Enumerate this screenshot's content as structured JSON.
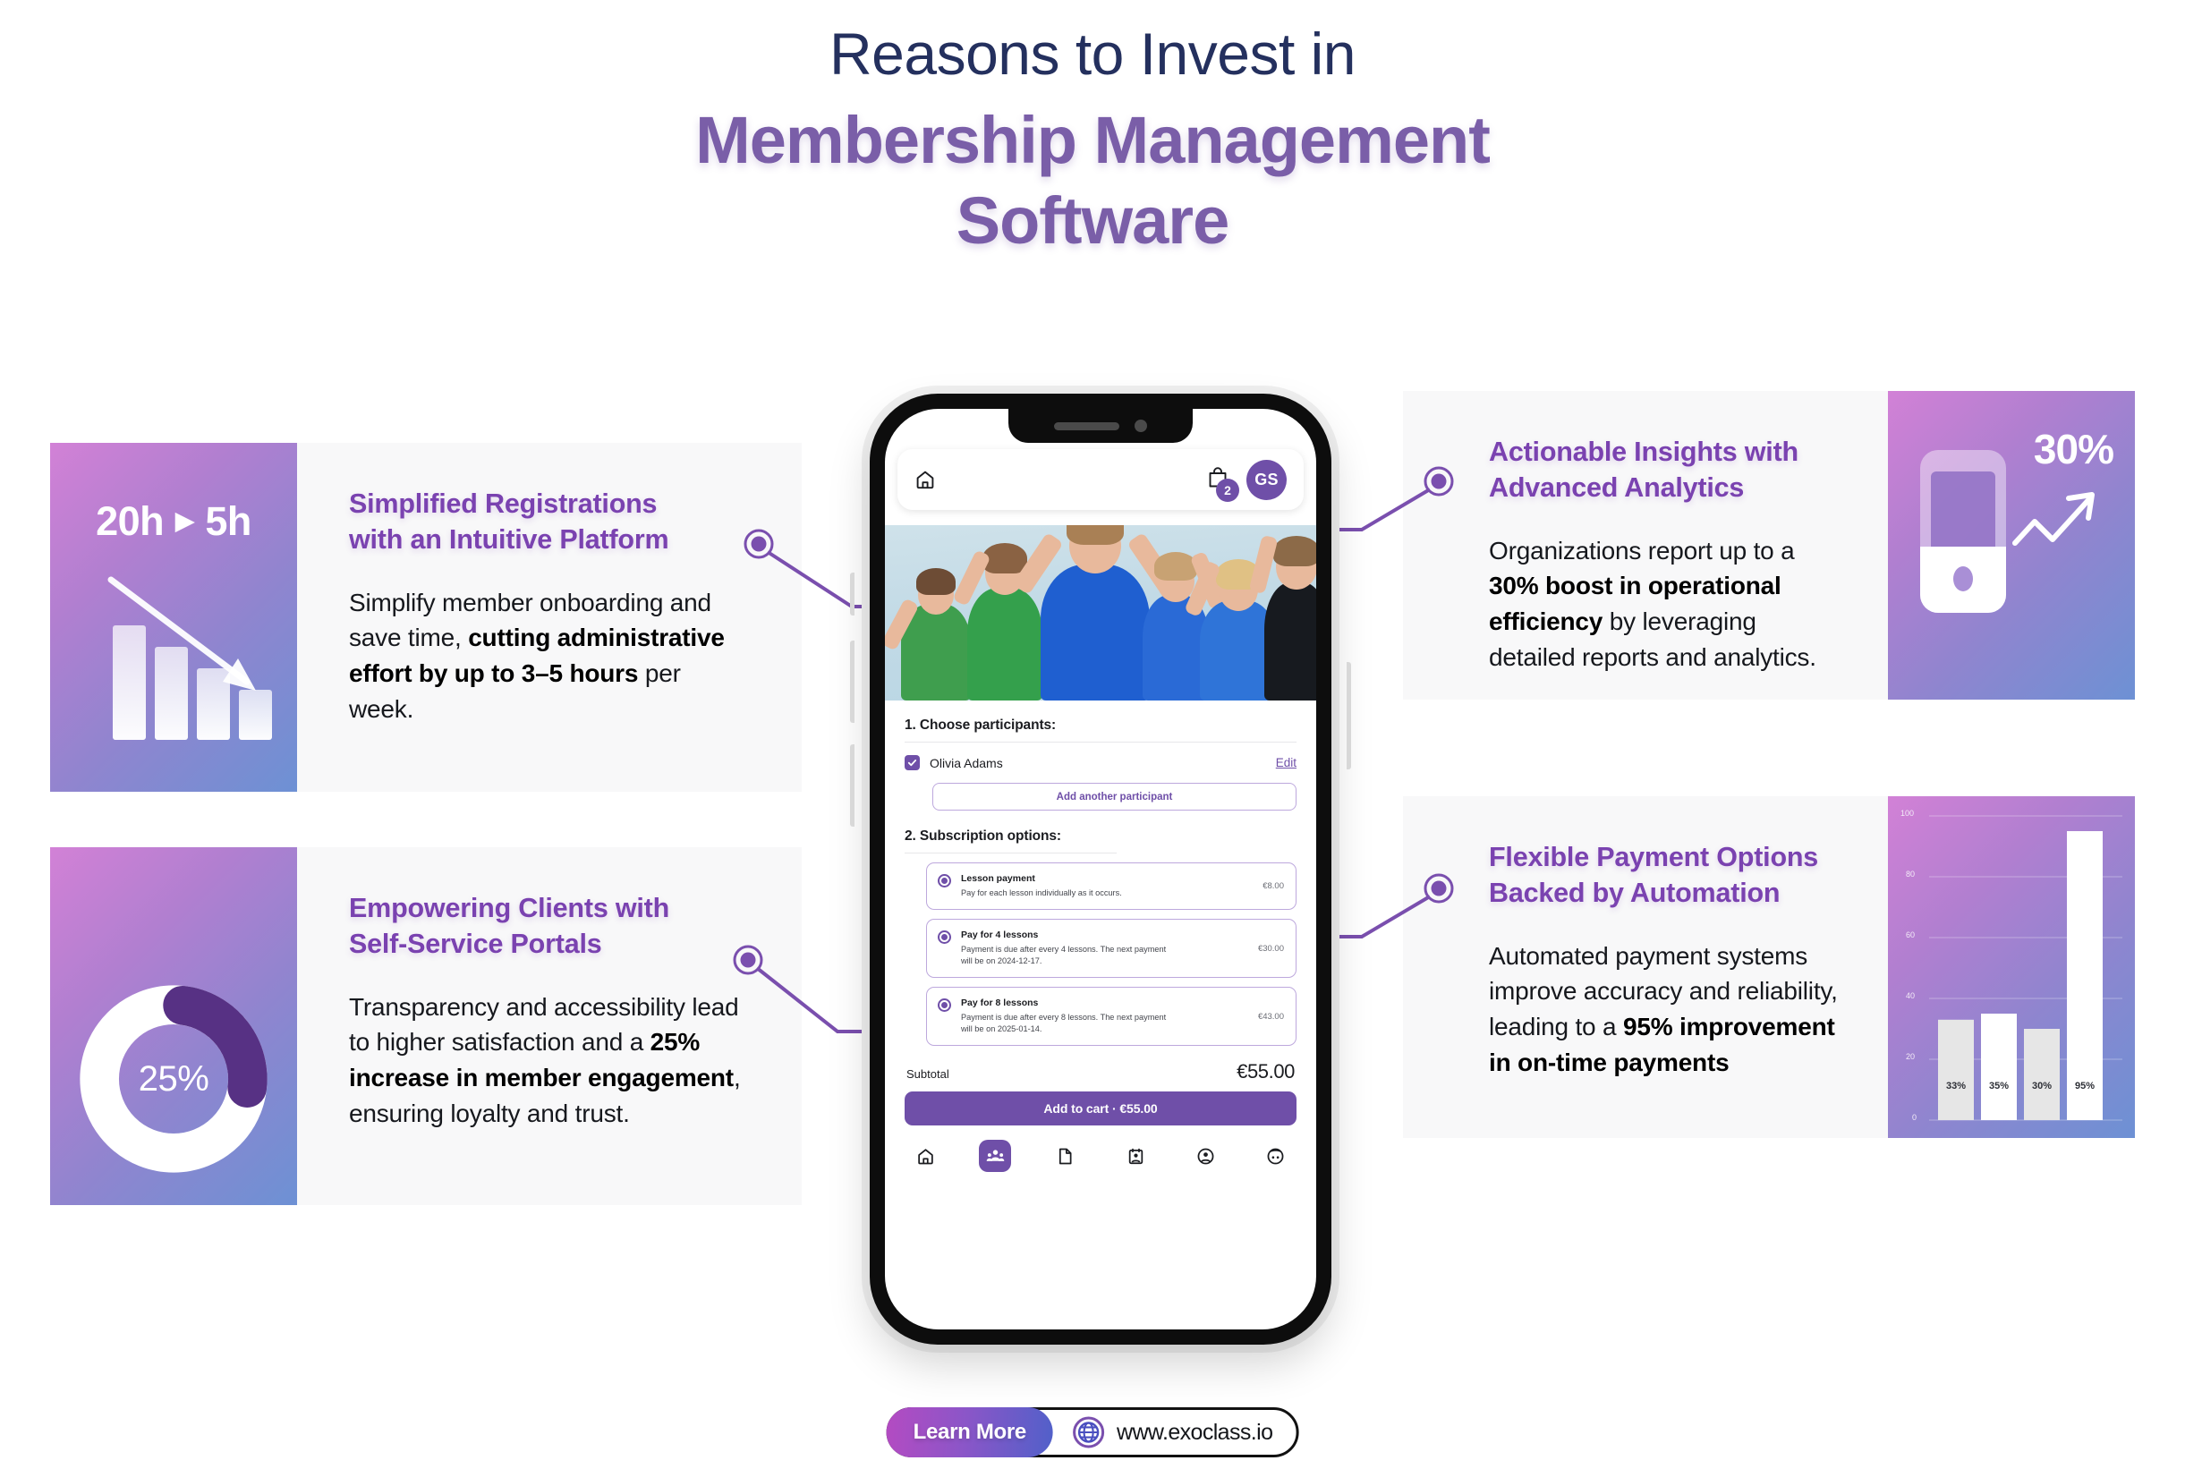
{
  "title": {
    "line1": "Reasons to Invest in",
    "line2_a": "Membership Management",
    "line2_b": "Software",
    "color_navy": "#24305e",
    "color_purple": "#7a5ea8"
  },
  "cards": [
    {
      "id": "simplified-registrations",
      "heading_l1": "Simplified Registrations",
      "heading_l2": "with an Intuitive Platform",
      "body_parts": [
        {
          "t": "Simplify member onboarding and save time, ",
          "b": false
        },
        {
          "t": "cutting administrative effort by up to 3–5 hours",
          "b": true
        },
        {
          "t": " per week.",
          "b": false
        }
      ],
      "visual": {
        "kind": "bars-down",
        "from_label": "20h",
        "to_label": "5h",
        "arrow_glyph": "▶",
        "bar_heights": [
          128,
          104,
          80,
          56
        ]
      }
    },
    {
      "id": "empowering-clients",
      "heading_l1": "Empowering Clients with",
      "heading_l2": "Self-Service Portals",
      "body_parts": [
        {
          "t": "Transparency and accessibility lead to higher satisfaction and a ",
          "b": false
        },
        {
          "t": "25% increase in member engagement",
          "b": true
        },
        {
          "t": ", ensuring loyalty and trust.",
          "b": false
        }
      ],
      "visual": {
        "kind": "donut",
        "percent_label": "25%",
        "percent_value": 25
      }
    },
    {
      "id": "actionable-insights",
      "heading_l1": "Actionable Insights with",
      "heading_l2": "Advanced Analytics",
      "body_parts": [
        {
          "t": "Organizations report up to a ",
          "b": false
        },
        {
          "t": "30% boost in operational efficiency",
          "b": true
        },
        {
          "t": " by leveraging detailed reports and analytics.",
          "b": false
        }
      ],
      "visual": {
        "kind": "phone-trend",
        "percent_label": "30%"
      }
    },
    {
      "id": "flexible-payment-options",
      "heading_l1": "Flexible Payment Options",
      "heading_l2": "Backed by Automation",
      "body_parts": [
        {
          "t": "Automated payment systems improve accuracy and reliability, leading to a ",
          "b": false
        },
        {
          "t": "95% improvement in on-time payments",
          "b": true
        }
      ],
      "visual": {
        "kind": "bar-chart"
      }
    }
  ],
  "chart_data": {
    "type": "bar",
    "title": "",
    "categories": [
      "33%",
      "35%",
      "30%",
      "95%"
    ],
    "values": [
      33,
      35,
      30,
      95
    ],
    "data_labels": [
      "33%",
      "35%",
      "30%",
      "95%"
    ],
    "ylim": [
      0,
      100
    ],
    "yticks": [
      0,
      20,
      40,
      60,
      80,
      100
    ],
    "ytick_labels": [
      "0",
      "20",
      "40",
      "60",
      "80",
      "100"
    ],
    "xlabel": "",
    "ylabel": "",
    "grid": true,
    "legend": false,
    "bar_colors": [
      "#e6e6e6",
      "#ffffff",
      "#e6e6e6",
      "#ffffff"
    ],
    "background": "gradient purple to blue"
  },
  "phone": {
    "topbar": {
      "home_icon": "home-icon",
      "cart_icon": "shopping-bag-icon",
      "cart_badge": "2",
      "avatar_initials": "GS"
    },
    "step1_title": "1. Choose participants:",
    "participant": {
      "name": "Olivia Adams",
      "edit_label": "Edit",
      "checked": true
    },
    "add_participant_label": "Add another participant",
    "step2_title": "2. Subscription options:",
    "options": [
      {
        "title": "Lesson payment",
        "desc": "Pay for each lesson individually as it occurs.",
        "price": "€8.00"
      },
      {
        "title": "Pay for 4 lessons",
        "desc": "Payment is due after every 4 lessons. The next payment will be on 2024-12-17.",
        "price": "€30.00"
      },
      {
        "title": "Pay for 8 lessons",
        "desc": "Payment is due after every 8 lessons. The next payment will be on 2025-01-14.",
        "price": "€43.00"
      }
    ],
    "subtotal_label": "Subtotal",
    "subtotal_value": "€55.00",
    "cta_label": "Add to cart · €55.00",
    "tabs": [
      {
        "icon": "home-icon",
        "active": false
      },
      {
        "icon": "people-group-icon",
        "active": true
      },
      {
        "icon": "document-icon",
        "active": false
      },
      {
        "icon": "id-card-icon",
        "active": false
      },
      {
        "icon": "user-circle-icon",
        "active": false
      },
      {
        "icon": "child-face-icon",
        "active": false
      }
    ]
  },
  "footer": {
    "learn_more_label": "Learn More",
    "globe_icon": "globe-icon",
    "website": "www.exoclass.io"
  },
  "theme": {
    "accent_purple": "#6f4fa8",
    "heading_purple": "#7a42b0",
    "gradient_from": "#d281d6",
    "gradient_to": "#6d91d4",
    "card_bg": "#f8f8f9"
  }
}
